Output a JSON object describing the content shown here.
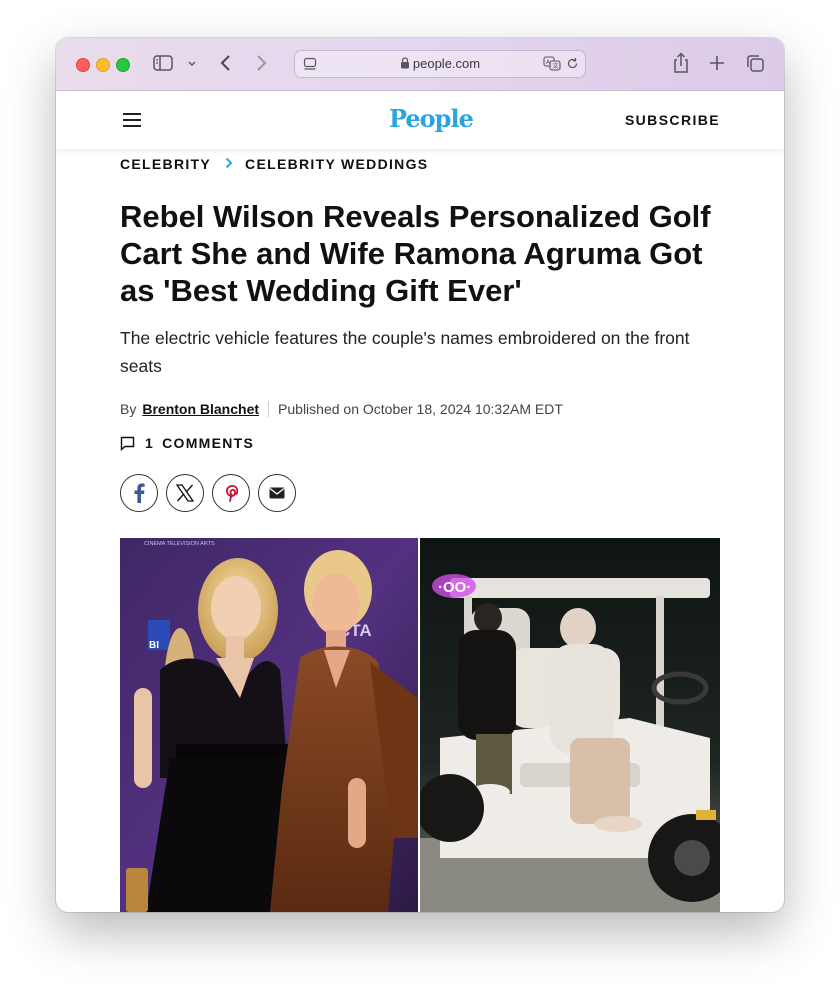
{
  "browser": {
    "url": "people.com",
    "icons": [
      "sidebar-icon",
      "chevron-down-icon",
      "back-icon",
      "forward-icon",
      "reader-icon",
      "lock-icon",
      "translate-icon",
      "reload-icon",
      "share-icon",
      "new-tab-icon",
      "tabs-overview-icon"
    ]
  },
  "site": {
    "logo": "People",
    "subscribe_label": "SUBSCRIBE"
  },
  "breadcrumb": {
    "items": [
      "CELEBRITY",
      "CELEBRITY WEDDINGS"
    ]
  },
  "article": {
    "title": "Rebel Wilson Reveals Personalized Golf Cart She and Wife Ramona Agruma Got as 'Best Wedding Gift Ever'",
    "subhead": "The electric vehicle features the couple's names embroidered on the front seats",
    "by_prefix": "By",
    "author": "Brenton Blanchet",
    "published": "Published on October 18, 2024 10:32AM EDT",
    "comments_count": "1",
    "comments_label": "COMMENTS",
    "photo_caption_text": "CINEMA TELEVISION ARTS"
  },
  "share_buttons": [
    "facebook-icon",
    "x-icon",
    "pinterest-icon",
    "email-icon"
  ],
  "colors": {
    "accent": "#29a6e0",
    "toolbar": "#e6d8ed"
  }
}
